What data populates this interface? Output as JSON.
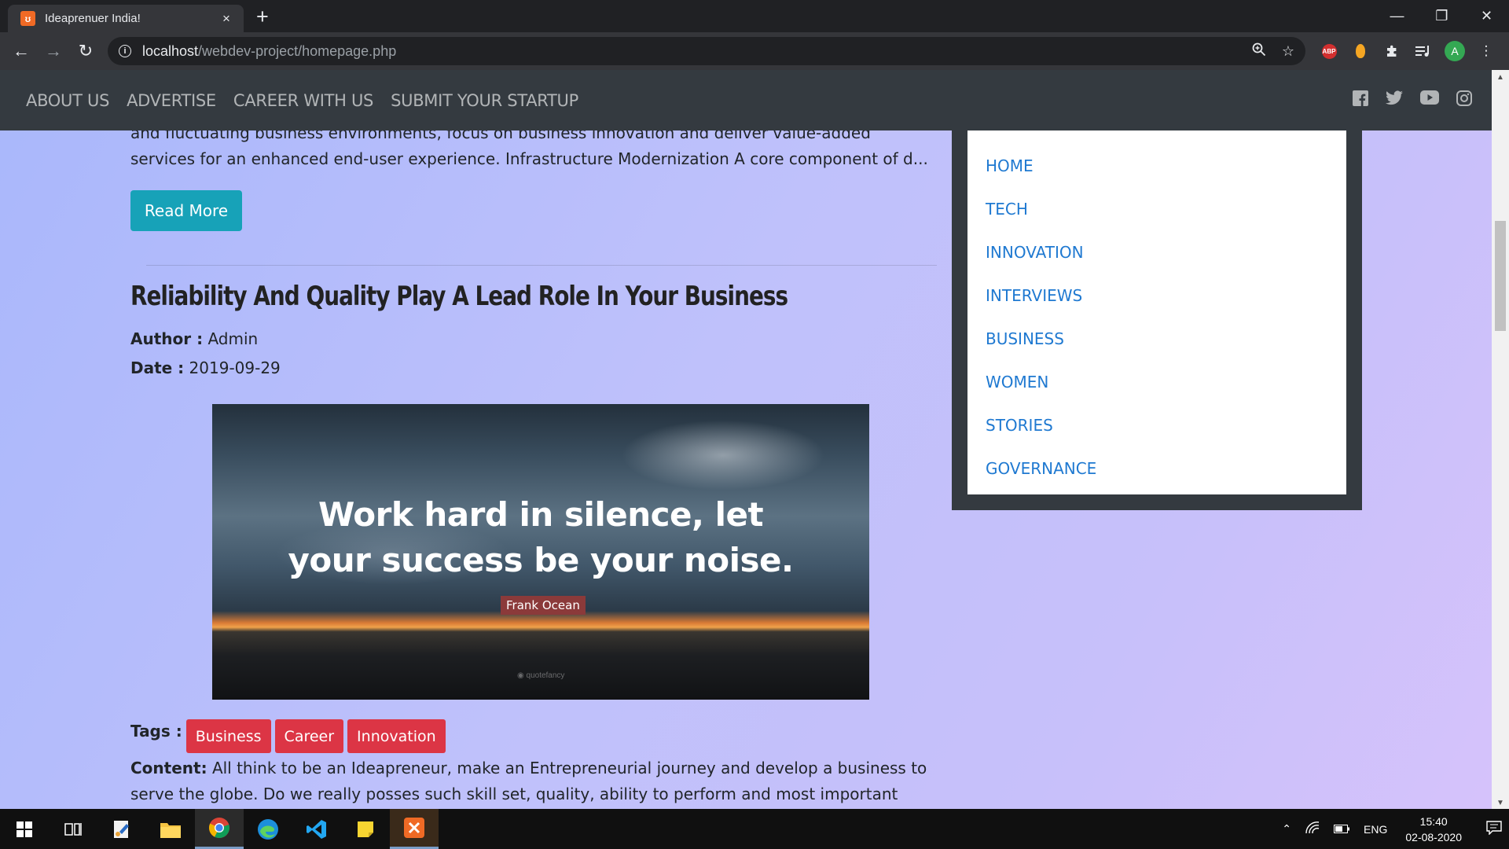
{
  "browser": {
    "tab_title": "Ideaprenuer India!",
    "tab_close": "×",
    "new_tab": "+",
    "url_host": "localhost",
    "url_path": "/webdev-project/homepage.php",
    "avatar_letter": "A",
    "abp_label": "ABP"
  },
  "site_nav": {
    "links": [
      "ABOUT US",
      "ADVERTISE",
      "CAREER WITH US",
      "SUBMIT YOUR STARTUP"
    ],
    "social_icons": [
      "facebook-icon",
      "twitter-icon",
      "youtube-icon",
      "instagram-icon"
    ]
  },
  "previous_post": {
    "excerpt": "and fluctuating business environments, focus on business innovation and deliver value-added services for an enhanced end-user experience. Infrastructure Modernization A core component of d...",
    "read_more": "Read More"
  },
  "post": {
    "title": "Reliability And Quality Play A Lead Role In Your Business",
    "author_label": "Author :",
    "author": "Admin",
    "date_label": "Date :",
    "date": "2019-09-29",
    "image_quote_line1": "Work hard in silence, let",
    "image_quote_line2": "your success be your noise.",
    "image_quote_author": "Frank Ocean",
    "image_watermark": "◉ quotefancy",
    "tags_label": "Tags :",
    "tags": [
      "Business",
      "Career",
      "Innovation"
    ],
    "content_label": "Content:",
    "content": "All think to be an Ideapreneur, make an Entrepreneurial journey and develop a business to serve the globe. Do we really posses such skill set, quality, ability to perform and most important reliability. Yes"
  },
  "sidebar": {
    "categories": [
      "HOME",
      "TECH",
      "INNOVATION",
      "INTERVIEWS",
      "BUSINESS",
      "WOMEN",
      "STORIES",
      "GOVERNANCE"
    ]
  },
  "taskbar": {
    "language": "ENG",
    "time": "15:40",
    "date": "02-08-2020"
  },
  "colors": {
    "read_more": "#17a2b8",
    "tag": "#dc3545",
    "nav": "#343a40",
    "category_link": "#1f79d1"
  }
}
